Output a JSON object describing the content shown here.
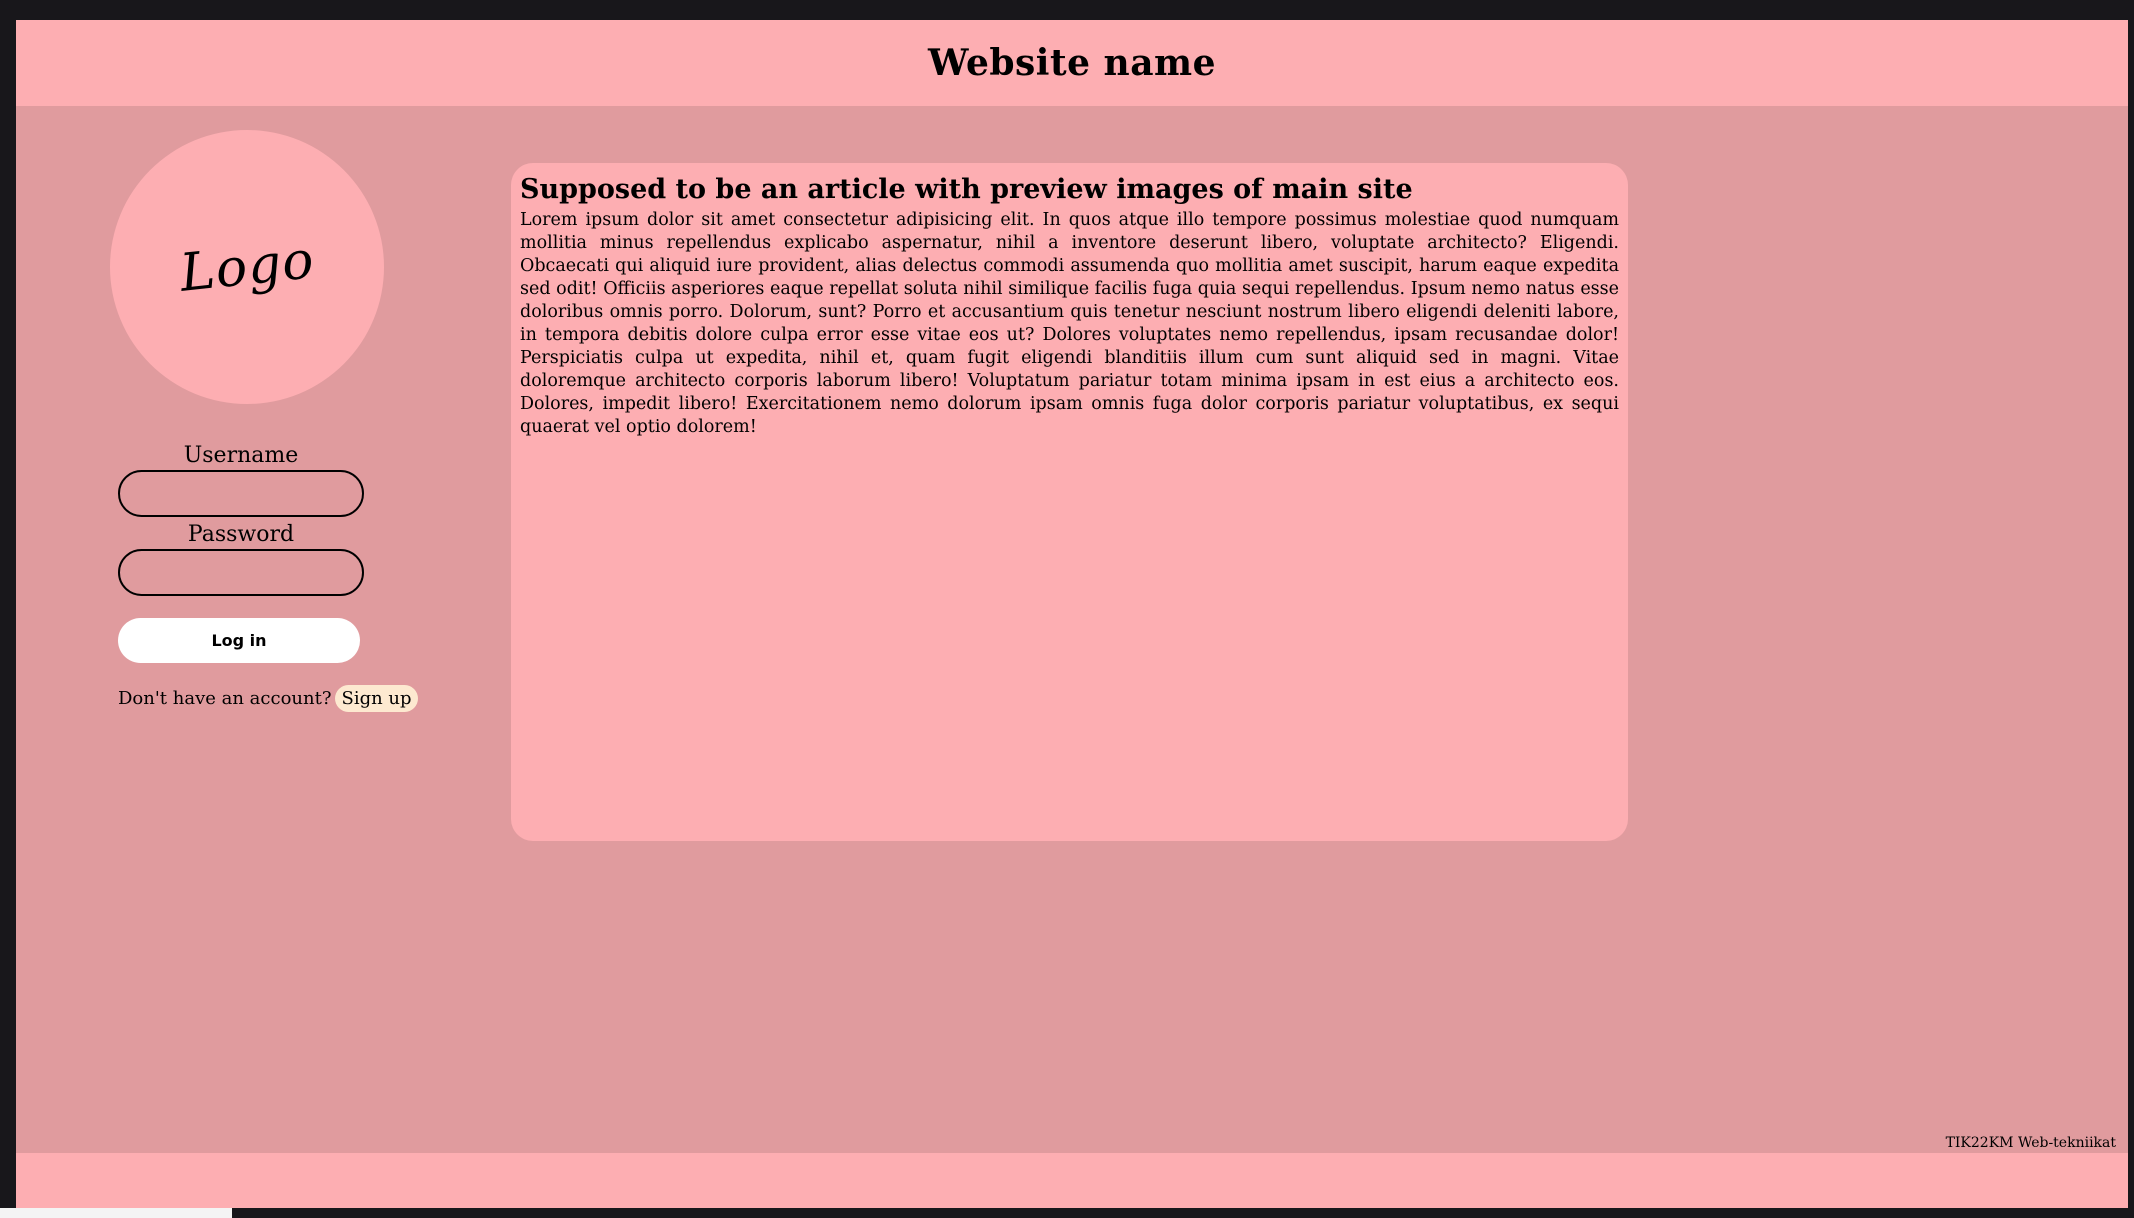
{
  "header": {
    "title": "Website name"
  },
  "logo": {
    "text": "Logo"
  },
  "login": {
    "username_label": "Username",
    "username_value": "",
    "password_label": "Password",
    "password_value": "",
    "login_button": "Log in",
    "signup_prompt": "Don't have an account?",
    "signup_link": "Sign up"
  },
  "article": {
    "title": "Supposed to be an article with preview images of main site",
    "body": "Lorem ipsum dolor sit amet consectetur adipisicing elit. In quos atque illo tempore possimus molestiae quod numquam mollitia minus repellendus explicabo aspernatur, nihil a inventore deserunt libero, voluptate architecto? Eligendi. Obcaecati qui aliquid iure provident, alias delectus commodi assumenda quo mollitia amet suscipit, harum eaque expedita sed odit! Officiis asperiores eaque repellat soluta nihil similique facilis fuga quia sequi repellendus. Ipsum nemo natus esse doloribus omnis porro. Dolorum, sunt? Porro et accusantium quis tenetur nesciunt nostrum libero eligendi deleniti labore, in tempora debitis dolore culpa error esse vitae eos ut? Dolores voluptates nemo repellendus, ipsam recusandae dolor! Perspiciatis culpa ut expedita, nihil et, quam fugit eligendi blanditiis illum cum sunt aliquid sed in magni. Vitae doloremque architecto corporis laborum libero! Voluptatum pariatur totam minima ipsam in est eius a architecto eos. Dolores, impedit libero! Exercitationem nemo dolorum ipsam omnis fuga dolor corporis pariatur voluptatibus, ex sequi quaerat vel optio dolorem!"
  },
  "footer": {
    "note": "TIK22KM Web-tekniikat"
  },
  "colors": {
    "header_bg": "#fdaeb2",
    "page_bg": "#e09b9e",
    "frame_bg": "#18171b",
    "button_bg": "#ffffff",
    "signup_bg": "#fde9d0"
  }
}
